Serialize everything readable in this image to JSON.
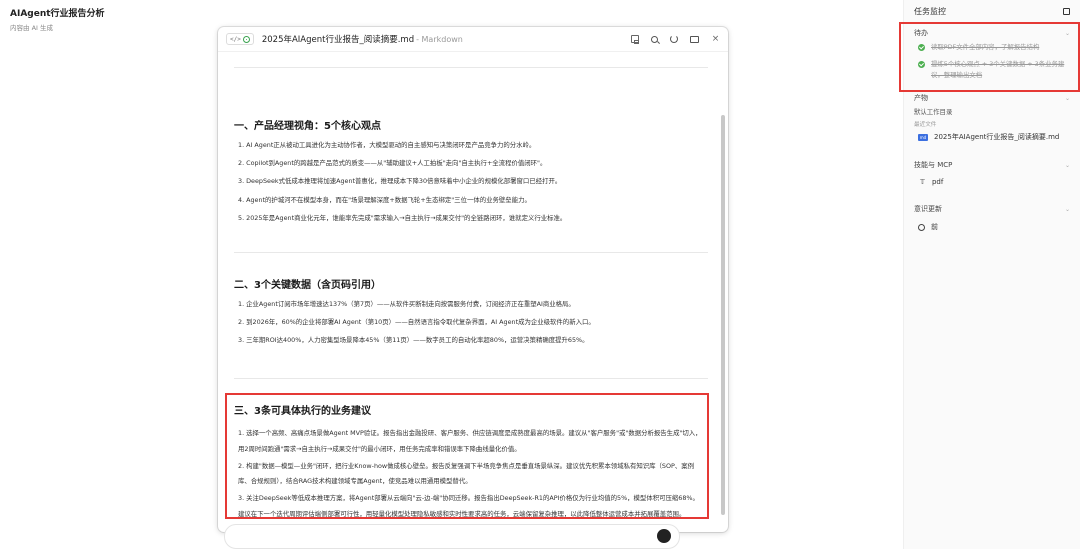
{
  "app": {
    "title": "AIAgent行业报告分析",
    "subtitle": "内容由 AI 生成"
  },
  "doc": {
    "type_icon": "code-preview-icon",
    "type_code": "</>",
    "filename": "2025年AIAgent行业报告_阅读摘要.md",
    "kind": " - Markdown",
    "tools": [
      "save-icon",
      "search-icon",
      "refresh-icon",
      "open-folder-icon",
      "close-icon"
    ],
    "close_glyph": "×",
    "sections": [
      {
        "heading": "一、产品经理视角：5个核心观点",
        "items": [
          "1. AI Agent正从被动工具进化为主动协作者，大模型驱动的自主感知与决策闭环是产品竞争力的分水岭。",
          "2. Copilot到Agent的跨越是产品范式的质变——从\"辅助建议+人工拍板\"走向\"自主执行+全流程价值闭环\"。",
          "3. DeepSeek式低成本推理将加速Agent普惠化，推理成本下降30倍意味着中小企业的规模化部署窗口已经打开。",
          "4. Agent的护城河不在模型本身，而在\"场景理解深度+数据飞轮+生态绑定\"三位一体的业务壁垒能力。",
          "5. 2025年是Agent商业化元年，谁能率先完成\"需求输入→自主执行→成果交付\"的全链路闭环，谁就定义行业标准。"
        ]
      },
      {
        "heading": "二、3个关键数据（含页码引用）",
        "items": [
          "1. 企业Agent订阅市场年增速达137%（第7页）——从软件买断制走向按需服务付费，订阅经济正在重塑AI商业格局。",
          "2. 到2026年，60%的企业将部署AI Agent（第10页）——自然语言指令取代复杂界面，AI Agent成为企业级软件的新入口。",
          "3. 三年期ROI达400%，人力密集型场景降本45%（第11页）——数字员工的自动化率超80%，运营决策精确度提升65%。"
        ]
      },
      {
        "heading": "三、3条可具体执行的业务建议",
        "items": [
          "1. 选择一个高频、高痛点场景做Agent MVP验证。报告指出金融投研、客户服务、供应链调度是成熟度最高的场景。建议从\"客户服务\"或\"数据分析报告生成\"切入，用2周时间跑通\"需求→自主执行→成果交付\"的最小闭环，用任务完成率和错误率下降曲线量化价值。",
          "2. 构建\"数据—模型—业务\"闭环，把行业Know-how做成核心壁垒。报告反复强调下半场竞争焦点是垂直场景纵深。建议优先积累本领域私有知识库（SOP、案例库、合规规则），结合RAG技术构建领域专属Agent，使竞品难以用通用模型替代。",
          "3. 关注DeepSeek等低成本推理方案，将Agent部署从云端向\"云-边-端\"协同迁移。报告指出DeepSeek-R1的API价格仅为行业均值的5%，模型体积可压缩68%。建议在下一个迭代周期评估端侧部署可行性，用轻量化模型处理隐私敏感和实时性要求高的任务，云端保留复杂推理，以此降低整体运营成本并拓展覆盖范围。"
        ]
      }
    ]
  },
  "side": {
    "title": "任务监控",
    "todo": {
      "label": "待办",
      "items": [
        "读取PDF文件全部内容，了解报告结构",
        "提炼5个核心观点 + 3个关键数据 + 3条业务建议，整理输出文档"
      ]
    },
    "artifacts": {
      "label": "产物",
      "default_dir": "默认工作目录",
      "recent_label": "最近文件",
      "file_badge": "md",
      "file": "2025年AIAgent行业报告_阅读摘要.md"
    },
    "skills": {
      "label": "技能与 MCP",
      "item": "pdf"
    },
    "memory": {
      "label": "意识更新",
      "item": "前"
    }
  },
  "colors": {
    "highlight": "#e53935",
    "check": "#4caf50",
    "md_badge": "#3b6fe0"
  }
}
